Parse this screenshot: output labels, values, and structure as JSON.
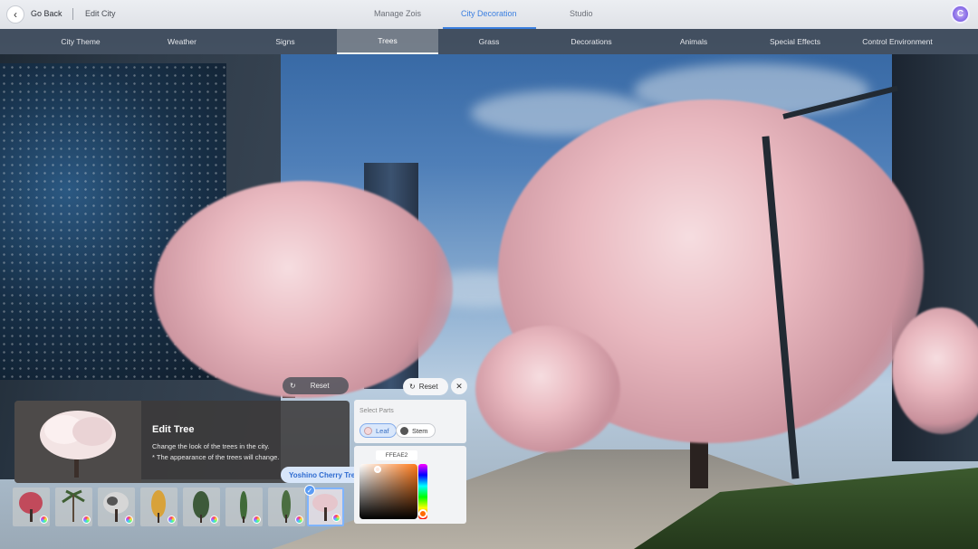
{
  "topbar": {
    "back_label": "Go Back",
    "breadcrumb": "Edit City",
    "tabs": [
      {
        "label": "Manage Zois",
        "active": false
      },
      {
        "label": "City Decoration",
        "active": true
      },
      {
        "label": "Studio",
        "active": false
      }
    ],
    "avatar_glyph": "C"
  },
  "subtabs": [
    {
      "label": "City Theme",
      "active": false
    },
    {
      "label": "Weather",
      "active": false
    },
    {
      "label": "Signs",
      "active": false
    },
    {
      "label": "Trees",
      "active": true
    },
    {
      "label": "Grass",
      "active": false
    },
    {
      "label": "Decorations",
      "active": false
    },
    {
      "label": "Animals",
      "active": false
    },
    {
      "label": "Special Effects",
      "active": false
    },
    {
      "label": "Control Environment",
      "active": false
    }
  ],
  "scene_controls": {
    "reset_dark_label": "Reset",
    "reset_light_label": "Reset",
    "close_glyph": "✕"
  },
  "edit_panel": {
    "title": "Edit Tree",
    "desc_line1": "Change the look of the trees in the city.",
    "desc_line2": "* The appearance of the trees will change."
  },
  "tree_items": [
    {
      "icon": "red-flower-tree-icon",
      "selected": false
    },
    {
      "icon": "palm-tree-icon",
      "selected": false
    },
    {
      "icon": "white-flower-tree-icon",
      "selected": false
    },
    {
      "icon": "golden-tree-icon",
      "selected": false
    },
    {
      "icon": "pine-tree-icon",
      "selected": false
    },
    {
      "icon": "cypress-tree-icon",
      "selected": false
    },
    {
      "icon": "tall-conifer-icon",
      "selected": false
    },
    {
      "icon": "cherry-blossom-tree-icon",
      "selected": true
    }
  ],
  "tooltip": "Yoshino Cherry Tree",
  "parts": {
    "label": "Select Parts",
    "options": [
      {
        "label": "Leaf",
        "active": true,
        "color": "#f5d7d9"
      },
      {
        "label": "Stem",
        "active": false,
        "color": "#555555"
      }
    ]
  },
  "color_picker": {
    "hex": "FFEAE2",
    "value_color": "#ffeae2",
    "hue_color": "#ff6a00"
  }
}
